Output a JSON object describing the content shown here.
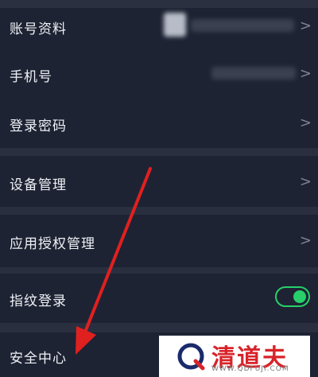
{
  "settings": {
    "account_info": {
      "label": "账号资料"
    },
    "phone": {
      "label": "手机号"
    },
    "login_password": {
      "label": "登录密码"
    },
    "device_management": {
      "label": "设备管理"
    },
    "app_authorization": {
      "label": "应用授权管理"
    },
    "fingerprint_login": {
      "label": "指纹登录",
      "enabled": true
    },
    "security_center": {
      "label": "安全中心"
    }
  },
  "chevron_glyph": ">",
  "watermark": {
    "title": "清道夫",
    "url": "WWW.QDFUJI.COM"
  },
  "colors": {
    "background": "#1b2030",
    "row": "#1e2333",
    "divider": "#2a2f3f",
    "toggle_on": "#27d06a",
    "annotation_arrow": "#e0201f",
    "watermark_red": "#d8232a"
  }
}
